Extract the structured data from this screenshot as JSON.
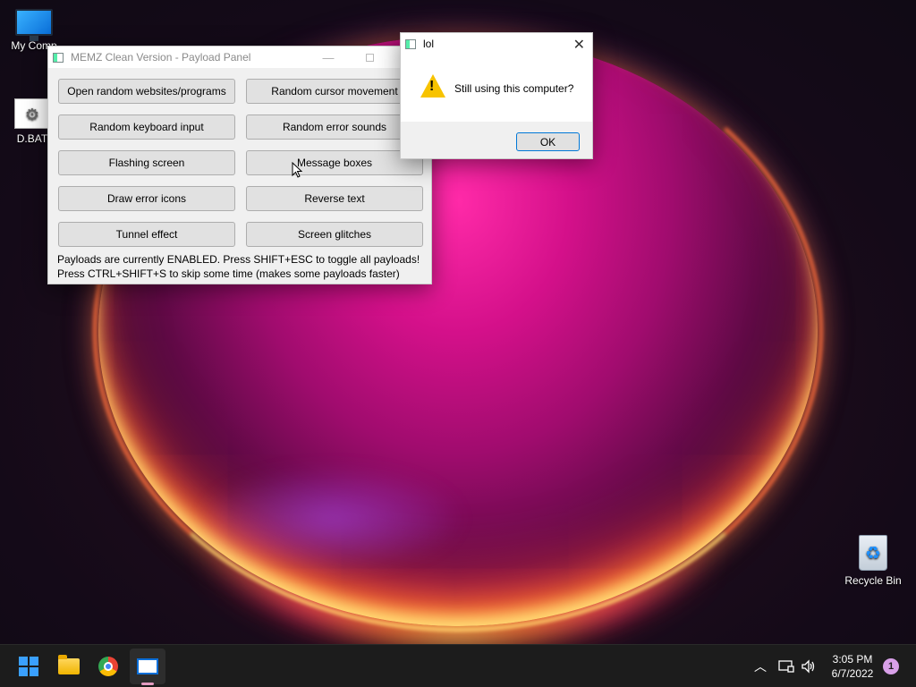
{
  "desktop": {
    "icons": [
      {
        "label": "My Comp"
      },
      {
        "label": "D.BAT"
      },
      {
        "label": "Recycle Bin"
      }
    ]
  },
  "memz_window": {
    "title": "MEMZ Clean Version - Payload Panel",
    "buttons": [
      "Open random websites/programs",
      "Random cursor movement",
      "Random keyboard input",
      "Random error sounds",
      "Flashing screen",
      "Message boxes",
      "Draw error icons",
      "Reverse text",
      "Tunnel effect",
      "Screen glitches"
    ],
    "status_line1": "Payloads are currently ENABLED. Press SHIFT+ESC to toggle all payloads!",
    "status_line2": "Press CTRL+SHIFT+S to skip some time (makes some payloads faster)"
  },
  "dialog": {
    "title": "lol",
    "message": "Still using this computer?",
    "ok_label": "OK",
    "close_glyph": "✕"
  },
  "taskbar": {
    "time": "3:05 PM",
    "date": "6/7/2022",
    "notification_count": "1",
    "apps": [
      "start-icon",
      "file-explorer-icon",
      "chrome-icon",
      "memz-icon"
    ]
  },
  "colors": {
    "accent": "#0078d7",
    "warning": "#f7c300",
    "taskbar_bg": "#1c1c1c"
  }
}
